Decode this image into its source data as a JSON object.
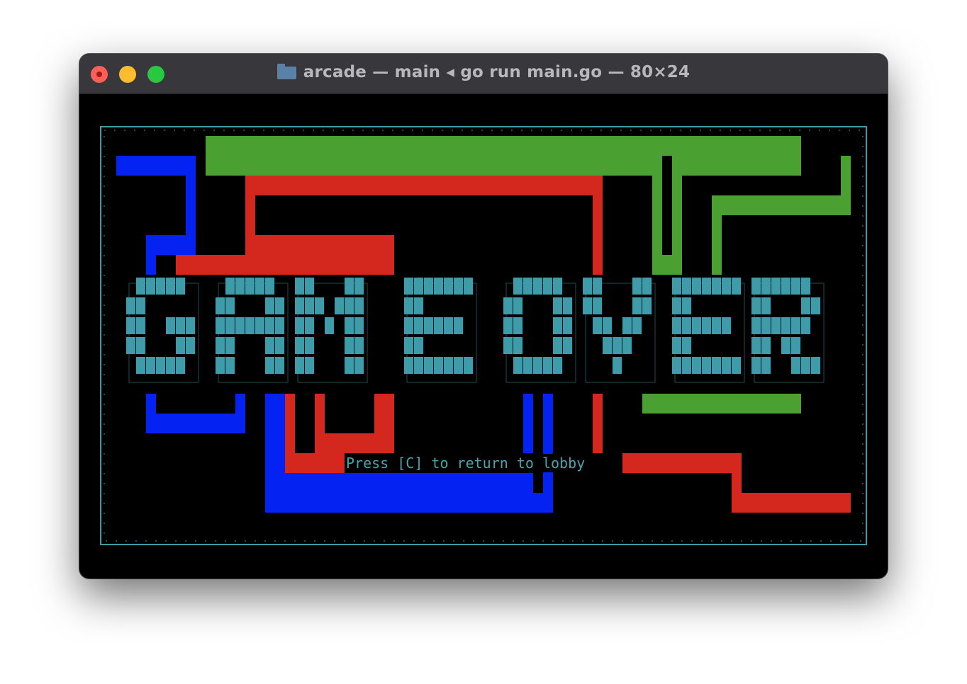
{
  "window": {
    "title": "arcade — main ◂ go run main.go — 80×24"
  },
  "icons": {
    "folder": "folder-icon",
    "close": "close-icon",
    "minimize": "minimize-icon",
    "zoom": "zoom-icon"
  },
  "colors": {
    "border": "#3d9ba6",
    "text": "#4aa3ad",
    "blue": "#0422f2",
    "red": "#d4281f",
    "green": "#4aa030",
    "logo": "#3f9ba7"
  },
  "game": {
    "banner": "GAME OVER",
    "prompt": "Press [C] to return to lobby"
  }
}
